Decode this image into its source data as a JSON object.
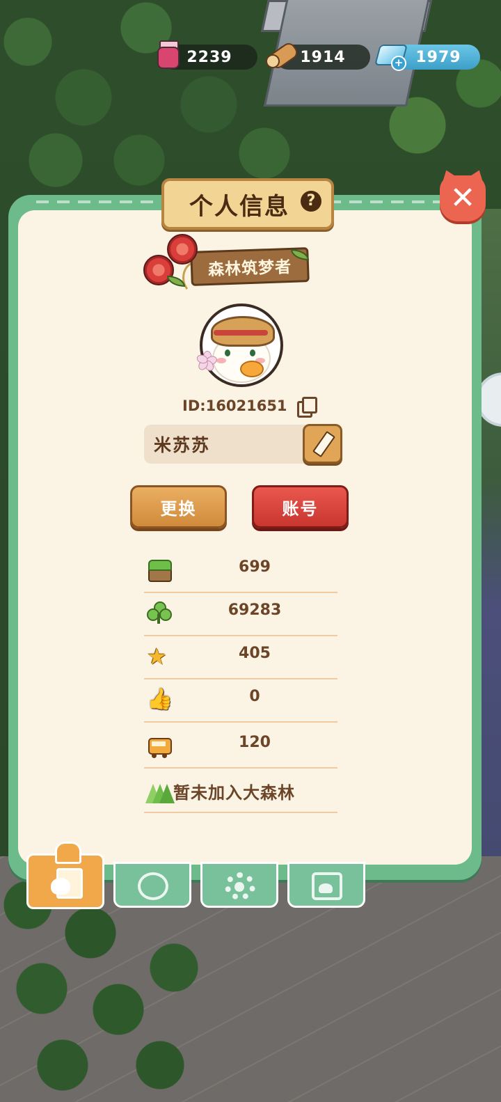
{
  "resources": {
    "jam": {
      "value": "2239",
      "icon": "jam-jar-icon"
    },
    "wood": {
      "value": "1914",
      "icon": "wood-log-icon"
    },
    "gems": {
      "value": "1979",
      "icon": "gem-icon",
      "add_icon": "plus-icon"
    }
  },
  "panel": {
    "title": "个人信息",
    "help": "?",
    "close": "✕"
  },
  "profile": {
    "title_badge": "森林筑梦者",
    "id": "ID:16021651",
    "name": "米苏苏",
    "change_button": "更换",
    "account_button": "账号"
  },
  "stats": [
    {
      "icon": "grass-block-icon",
      "value": "699"
    },
    {
      "icon": "clover-icon",
      "value": "69283"
    },
    {
      "icon": "star-icon",
      "value": "405"
    },
    {
      "icon": "thumbs-up-icon",
      "value": "0"
    },
    {
      "icon": "bus-icon",
      "value": "120"
    }
  ],
  "forest_status": "暂未加入大森林",
  "tabs": [
    {
      "icon": "profile-card-icon",
      "active": true
    },
    {
      "icon": "clover-badge-icon",
      "active": false
    },
    {
      "icon": "settings-gear-icon",
      "active": false
    },
    {
      "icon": "photo-album-icon",
      "active": false
    }
  ],
  "colors": {
    "panel_frame": "#6dbb8a",
    "panel_bg": "#fbf4e4",
    "text_brown": "#6c4528",
    "orange_button": "#e0a557",
    "red_button": "#d8433c",
    "close_red": "#ec6550"
  }
}
